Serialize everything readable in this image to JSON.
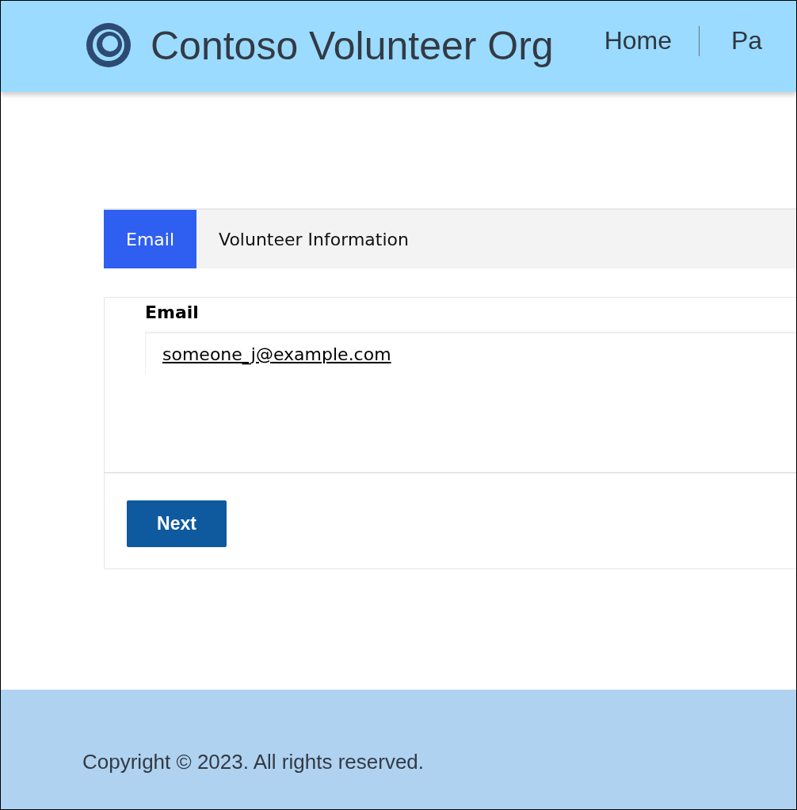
{
  "header": {
    "title": "Contoso Volunteer Org",
    "nav": [
      {
        "label": "Home"
      },
      {
        "label": "Pa"
      }
    ]
  },
  "tabs": [
    {
      "label": "Email",
      "selected": true
    },
    {
      "label": "Volunteer Information",
      "selected": false
    }
  ],
  "form": {
    "field": {
      "label": "Email",
      "value": "someone_j@example.com"
    },
    "button": "Next"
  },
  "footer": {
    "copyright": "Copyright © 2023. All rights reserved."
  }
}
